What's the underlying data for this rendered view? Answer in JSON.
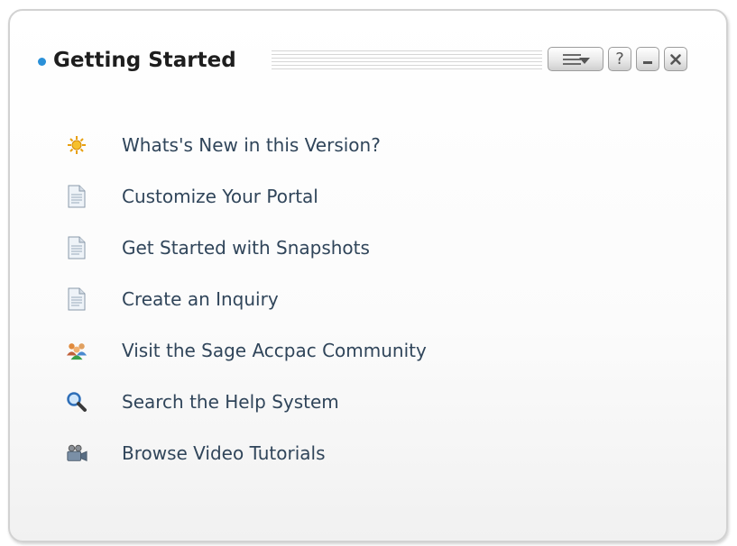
{
  "widget": {
    "title": "Getting Started",
    "toolbar": {
      "menu_icon": "menu-dropdown-icon",
      "help_label": "?",
      "minimize_icon": "minimize-icon",
      "close_icon": "close-icon"
    }
  },
  "items": [
    {
      "label": "Whats's New in this Version?",
      "icon": "sun-icon"
    },
    {
      "label": "Customize Your Portal",
      "icon": "document-icon"
    },
    {
      "label": "Get Started with Snapshots",
      "icon": "document-icon"
    },
    {
      "label": "Create an Inquiry",
      "icon": "document-icon"
    },
    {
      "label": "Visit the Sage Accpac Community",
      "icon": "people-icon"
    },
    {
      "label": "Search the Help System",
      "icon": "magnifier-icon"
    },
    {
      "label": "Browse Video Tutorials",
      "icon": "video-camera-icon"
    }
  ],
  "colors": {
    "link_text": "#30455a",
    "title_text": "#1e1e1e",
    "bullet": "#2a90d8",
    "border": "#d2d2d2"
  }
}
